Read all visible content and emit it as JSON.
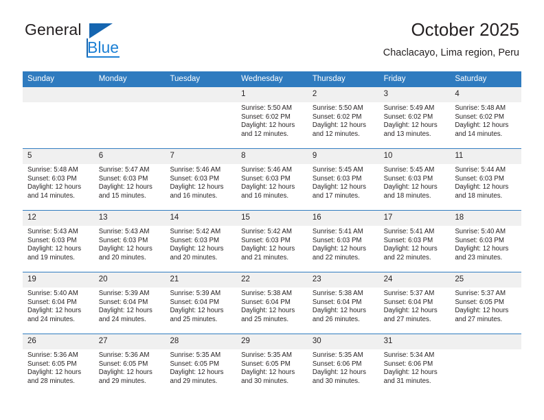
{
  "brand": {
    "name_part1": "General",
    "name_part2": "Blue",
    "triangle_color": "#1565b0",
    "blue_color": "#1b7fd4"
  },
  "header": {
    "title": "October 2025",
    "subtitle": "Chaclacayo, Lima region, Peru"
  },
  "theme": {
    "header_blue": "#2f7bbf",
    "day_band": "#f0f0f0",
    "text": "#231f20"
  },
  "weekdays": [
    "Sunday",
    "Monday",
    "Tuesday",
    "Wednesday",
    "Thursday",
    "Friday",
    "Saturday"
  ],
  "labels": {
    "sunrise": "Sunrise:",
    "sunset": "Sunset:",
    "daylight": "Daylight:"
  },
  "weeks": [
    [
      {
        "day": "",
        "empty": true
      },
      {
        "day": "",
        "empty": true
      },
      {
        "day": "",
        "empty": true
      },
      {
        "day": "1",
        "sunrise": "Sunrise: 5:50 AM",
        "sunset": "Sunset: 6:02 PM",
        "daylight_line1": "Daylight: 12 hours",
        "daylight_line2": "and 12 minutes."
      },
      {
        "day": "2",
        "sunrise": "Sunrise: 5:50 AM",
        "sunset": "Sunset: 6:02 PM",
        "daylight_line1": "Daylight: 12 hours",
        "daylight_line2": "and 12 minutes."
      },
      {
        "day": "3",
        "sunrise": "Sunrise: 5:49 AM",
        "sunset": "Sunset: 6:02 PM",
        "daylight_line1": "Daylight: 12 hours",
        "daylight_line2": "and 13 minutes."
      },
      {
        "day": "4",
        "sunrise": "Sunrise: 5:48 AM",
        "sunset": "Sunset: 6:02 PM",
        "daylight_line1": "Daylight: 12 hours",
        "daylight_line2": "and 14 minutes."
      }
    ],
    [
      {
        "day": "5",
        "sunrise": "Sunrise: 5:48 AM",
        "sunset": "Sunset: 6:03 PM",
        "daylight_line1": "Daylight: 12 hours",
        "daylight_line2": "and 14 minutes."
      },
      {
        "day": "6",
        "sunrise": "Sunrise: 5:47 AM",
        "sunset": "Sunset: 6:03 PM",
        "daylight_line1": "Daylight: 12 hours",
        "daylight_line2": "and 15 minutes."
      },
      {
        "day": "7",
        "sunrise": "Sunrise: 5:46 AM",
        "sunset": "Sunset: 6:03 PM",
        "daylight_line1": "Daylight: 12 hours",
        "daylight_line2": "and 16 minutes."
      },
      {
        "day": "8",
        "sunrise": "Sunrise: 5:46 AM",
        "sunset": "Sunset: 6:03 PM",
        "daylight_line1": "Daylight: 12 hours",
        "daylight_line2": "and 16 minutes."
      },
      {
        "day": "9",
        "sunrise": "Sunrise: 5:45 AM",
        "sunset": "Sunset: 6:03 PM",
        "daylight_line1": "Daylight: 12 hours",
        "daylight_line2": "and 17 minutes."
      },
      {
        "day": "10",
        "sunrise": "Sunrise: 5:45 AM",
        "sunset": "Sunset: 6:03 PM",
        "daylight_line1": "Daylight: 12 hours",
        "daylight_line2": "and 18 minutes."
      },
      {
        "day": "11",
        "sunrise": "Sunrise: 5:44 AM",
        "sunset": "Sunset: 6:03 PM",
        "daylight_line1": "Daylight: 12 hours",
        "daylight_line2": "and 18 minutes."
      }
    ],
    [
      {
        "day": "12",
        "sunrise": "Sunrise: 5:43 AM",
        "sunset": "Sunset: 6:03 PM",
        "daylight_line1": "Daylight: 12 hours",
        "daylight_line2": "and 19 minutes."
      },
      {
        "day": "13",
        "sunrise": "Sunrise: 5:43 AM",
        "sunset": "Sunset: 6:03 PM",
        "daylight_line1": "Daylight: 12 hours",
        "daylight_line2": "and 20 minutes."
      },
      {
        "day": "14",
        "sunrise": "Sunrise: 5:42 AM",
        "sunset": "Sunset: 6:03 PM",
        "daylight_line1": "Daylight: 12 hours",
        "daylight_line2": "and 20 minutes."
      },
      {
        "day": "15",
        "sunrise": "Sunrise: 5:42 AM",
        "sunset": "Sunset: 6:03 PM",
        "daylight_line1": "Daylight: 12 hours",
        "daylight_line2": "and 21 minutes."
      },
      {
        "day": "16",
        "sunrise": "Sunrise: 5:41 AM",
        "sunset": "Sunset: 6:03 PM",
        "daylight_line1": "Daylight: 12 hours",
        "daylight_line2": "and 22 minutes."
      },
      {
        "day": "17",
        "sunrise": "Sunrise: 5:41 AM",
        "sunset": "Sunset: 6:03 PM",
        "daylight_line1": "Daylight: 12 hours",
        "daylight_line2": "and 22 minutes."
      },
      {
        "day": "18",
        "sunrise": "Sunrise: 5:40 AM",
        "sunset": "Sunset: 6:03 PM",
        "daylight_line1": "Daylight: 12 hours",
        "daylight_line2": "and 23 minutes."
      }
    ],
    [
      {
        "day": "19",
        "sunrise": "Sunrise: 5:40 AM",
        "sunset": "Sunset: 6:04 PM",
        "daylight_line1": "Daylight: 12 hours",
        "daylight_line2": "and 24 minutes."
      },
      {
        "day": "20",
        "sunrise": "Sunrise: 5:39 AM",
        "sunset": "Sunset: 6:04 PM",
        "daylight_line1": "Daylight: 12 hours",
        "daylight_line2": "and 24 minutes."
      },
      {
        "day": "21",
        "sunrise": "Sunrise: 5:39 AM",
        "sunset": "Sunset: 6:04 PM",
        "daylight_line1": "Daylight: 12 hours",
        "daylight_line2": "and 25 minutes."
      },
      {
        "day": "22",
        "sunrise": "Sunrise: 5:38 AM",
        "sunset": "Sunset: 6:04 PM",
        "daylight_line1": "Daylight: 12 hours",
        "daylight_line2": "and 25 minutes."
      },
      {
        "day": "23",
        "sunrise": "Sunrise: 5:38 AM",
        "sunset": "Sunset: 6:04 PM",
        "daylight_line1": "Daylight: 12 hours",
        "daylight_line2": "and 26 minutes."
      },
      {
        "day": "24",
        "sunrise": "Sunrise: 5:37 AM",
        "sunset": "Sunset: 6:04 PM",
        "daylight_line1": "Daylight: 12 hours",
        "daylight_line2": "and 27 minutes."
      },
      {
        "day": "25",
        "sunrise": "Sunrise: 5:37 AM",
        "sunset": "Sunset: 6:05 PM",
        "daylight_line1": "Daylight: 12 hours",
        "daylight_line2": "and 27 minutes."
      }
    ],
    [
      {
        "day": "26",
        "sunrise": "Sunrise: 5:36 AM",
        "sunset": "Sunset: 6:05 PM",
        "daylight_line1": "Daylight: 12 hours",
        "daylight_line2": "and 28 minutes."
      },
      {
        "day": "27",
        "sunrise": "Sunrise: 5:36 AM",
        "sunset": "Sunset: 6:05 PM",
        "daylight_line1": "Daylight: 12 hours",
        "daylight_line2": "and 29 minutes."
      },
      {
        "day": "28",
        "sunrise": "Sunrise: 5:35 AM",
        "sunset": "Sunset: 6:05 PM",
        "daylight_line1": "Daylight: 12 hours",
        "daylight_line2": "and 29 minutes."
      },
      {
        "day": "29",
        "sunrise": "Sunrise: 5:35 AM",
        "sunset": "Sunset: 6:05 PM",
        "daylight_line1": "Daylight: 12 hours",
        "daylight_line2": "and 30 minutes."
      },
      {
        "day": "30",
        "sunrise": "Sunrise: 5:35 AM",
        "sunset": "Sunset: 6:06 PM",
        "daylight_line1": "Daylight: 12 hours",
        "daylight_line2": "and 30 minutes."
      },
      {
        "day": "31",
        "sunrise": "Sunrise: 5:34 AM",
        "sunset": "Sunset: 6:06 PM",
        "daylight_line1": "Daylight: 12 hours",
        "daylight_line2": "and 31 minutes."
      },
      {
        "day": "",
        "empty": true
      }
    ]
  ]
}
